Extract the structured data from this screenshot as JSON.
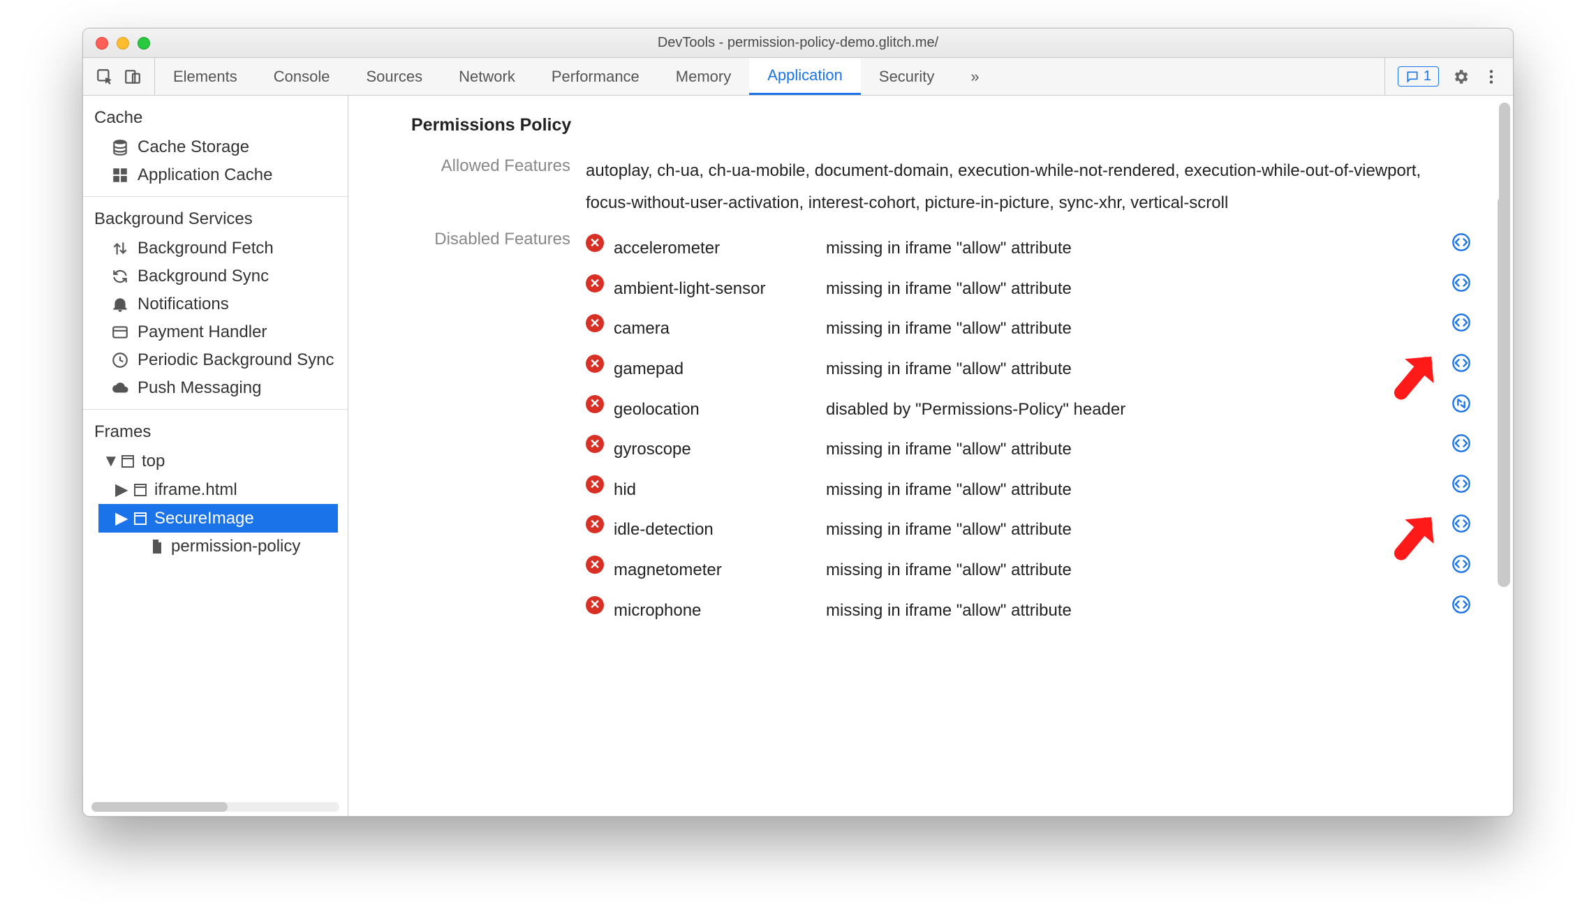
{
  "window": {
    "title": "DevTools - permission-policy-demo.glitch.me/"
  },
  "tabs": {
    "items": [
      "Elements",
      "Console",
      "Sources",
      "Network",
      "Performance",
      "Memory",
      "Application",
      "Security"
    ],
    "active": "Application",
    "overflow_glyph": "»",
    "issues_count": "1"
  },
  "sidebar": {
    "groups": [
      {
        "title": "Cache",
        "items": [
          {
            "icon": "database-icon",
            "label": "Cache Storage"
          },
          {
            "icon": "grid-icon",
            "label": "Application Cache"
          }
        ]
      },
      {
        "title": "Background Services",
        "items": [
          {
            "icon": "updown-icon",
            "label": "Background Fetch"
          },
          {
            "icon": "sync-icon",
            "label": "Background Sync"
          },
          {
            "icon": "bell-icon",
            "label": "Notifications"
          },
          {
            "icon": "card-icon",
            "label": "Payment Handler"
          },
          {
            "icon": "clock-icon",
            "label": "Periodic Background Sync"
          },
          {
            "icon": "cloud-icon",
            "label": "Push Messaging"
          }
        ]
      },
      {
        "title": "Frames",
        "tree": [
          {
            "depth": 0,
            "twisty": "▼",
            "icon": "frame-icon",
            "label": "top"
          },
          {
            "depth": 1,
            "twisty": "▶",
            "icon": "frame-icon",
            "label": "iframe.html"
          },
          {
            "depth": 1,
            "twisty": "▶",
            "icon": "frame-icon",
            "label": "SecureImage",
            "selected": true
          },
          {
            "depth": 2,
            "twisty": "",
            "icon": "document-icon",
            "label": "permission-policy"
          }
        ]
      }
    ]
  },
  "panel": {
    "title": "Permissions Policy",
    "allowed_label": "Allowed Features",
    "allowed_text": "autoplay, ch-ua, ch-ua-mobile, document-domain, execution-while-not-rendered, execution-while-out-of-viewport, focus-without-user-activation, interest-cohort, picture-in-picture, sync-xhr, vertical-scroll",
    "disabled_label": "Disabled Features",
    "reason_iframe": "missing in iframe \"allow\" attribute",
    "reason_header": "disabled by \"Permissions-Policy\" header",
    "disabled": [
      {
        "name": "accelerometer",
        "reason_key": "reason_iframe",
        "link": "code"
      },
      {
        "name": "ambient-light-sensor",
        "reason_key": "reason_iframe",
        "link": "code"
      },
      {
        "name": "camera",
        "reason_key": "reason_iframe",
        "link": "code"
      },
      {
        "name": "gamepad",
        "reason_key": "reason_iframe",
        "link": "code"
      },
      {
        "name": "geolocation",
        "reason_key": "reason_header",
        "link": "network"
      },
      {
        "name": "gyroscope",
        "reason_key": "reason_iframe",
        "link": "code"
      },
      {
        "name": "hid",
        "reason_key": "reason_iframe",
        "link": "code"
      },
      {
        "name": "idle-detection",
        "reason_key": "reason_iframe",
        "link": "code"
      },
      {
        "name": "magnetometer",
        "reason_key": "reason_iframe",
        "link": "code"
      },
      {
        "name": "microphone",
        "reason_key": "reason_iframe",
        "link": "code"
      }
    ]
  }
}
